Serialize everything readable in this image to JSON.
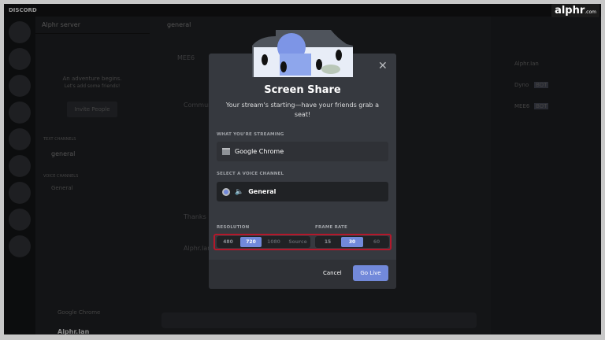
{
  "window": {
    "title": "DISCORD"
  },
  "watermark": {
    "brand": "alphr",
    "suffix": ".com"
  },
  "server": {
    "name": "Alphr server",
    "welcome_title": "An adventure begins.",
    "welcome_sub": "Let's add some friends!",
    "invite_label": "Invite People",
    "text_header": "TEXT CHANNELS",
    "text_channel": "general",
    "voice_header": "VOICE CHANNELS",
    "voice_channel": "General"
  },
  "stream_bar": {
    "label": "Google Chrome"
  },
  "user": {
    "name": "Alphr.Ian"
  },
  "chat": {
    "channel": "general",
    "lines": [
      "MEE6",
      "Community",
      "Thanks",
      "Alphr.Ian"
    ]
  },
  "members": [
    {
      "name": "Alphr.Ian"
    },
    {
      "name": "Dyno",
      "badge": "BOT"
    },
    {
      "name": "MEE6",
      "badge": "BOT"
    }
  ],
  "modal": {
    "title": "Screen Share",
    "subtitle": "Your stream's starting—have your friends grab a seat!",
    "streaming_label": "WHAT YOU'RE STREAMING",
    "streaming_value": "Google Chrome",
    "voice_label": "SELECT A VOICE CHANNEL",
    "voice_value": "General",
    "resolution_label": "RESOLUTION",
    "resolutions": [
      "480",
      "720",
      "1080",
      "Source"
    ],
    "resolution_selected": "720",
    "framerate_label": "FRAME RATE",
    "framerates": [
      "15",
      "30",
      "60"
    ],
    "framerate_selected": "30",
    "cancel": "Cancel",
    "go_live": "Go Live"
  },
  "colors": {
    "accent": "#7289da",
    "highlight": "#b4182b"
  }
}
